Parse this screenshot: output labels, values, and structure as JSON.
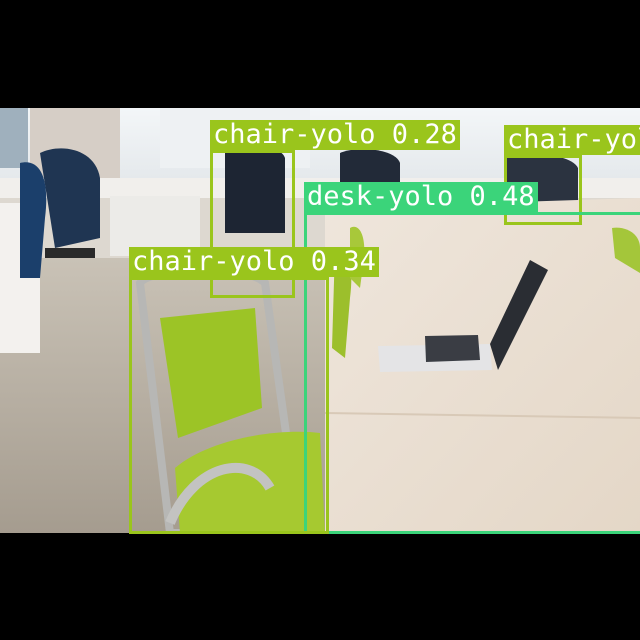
{
  "detections": [
    {
      "label": "chair-yolo 0.28",
      "color": "#9ac51c"
    },
    {
      "label": "chair-yolo",
      "color": "#9ac51c"
    },
    {
      "label": "desk-yolo 0.48",
      "color": "#3bd47a"
    },
    {
      "label": "chair-yolo 0.34",
      "color": "#9ac51c"
    }
  ]
}
